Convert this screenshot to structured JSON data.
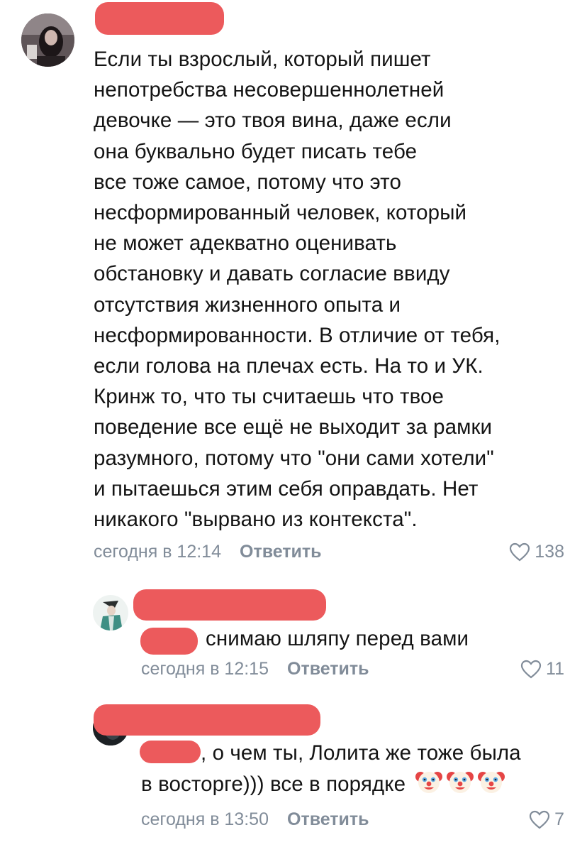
{
  "comments": [
    {
      "text_lines": [
        "Если ты взрослый, который пишет",
        "непотребства несовершеннолетней",
        "девочке — это твоя вина, даже если",
        "она буквально будет писать тебе",
        "все тоже самое, потому что это",
        "несформированный человек, который",
        "не может адекватно оценивать",
        "обстановку и давать согласие ввиду",
        "отсутствия жизненного опыта и",
        "несформированности. В отличие от тебя,",
        "если голова на плечах есть. На то и УК.",
        "Кринж то, что ты считаешь что твое",
        "поведение все ещё не выходит за рамки",
        "разумного, потому что \"они сами хотели\"",
        "и пытаешься этим себя оправдать. Нет",
        "никакого \"вырвано из контекста\"."
      ],
      "timestamp": "сегодня в 12:14",
      "reply_label": "Ответить",
      "likes": "138"
    },
    {
      "text": "снимаю шляпу перед вами",
      "timestamp": "сегодня в 12:15",
      "reply_label": "Ответить",
      "likes": "11"
    },
    {
      "text_lines": [
        ", о чем ты, Лолита же тоже была",
        "в восторге))) все в порядке"
      ],
      "emojis": [
        "clown-face",
        "clown-face",
        "clown-face"
      ],
      "timestamp": "сегодня в 13:50",
      "reply_label": "Ответить",
      "likes": "7"
    }
  ],
  "colors": {
    "redaction": "#ec5a5c",
    "meta_text": "#818c99",
    "body_text": "#141414",
    "mention": "#2a5885"
  },
  "icons": [
    "heart-outline-icon",
    "clown-face-icon"
  ]
}
